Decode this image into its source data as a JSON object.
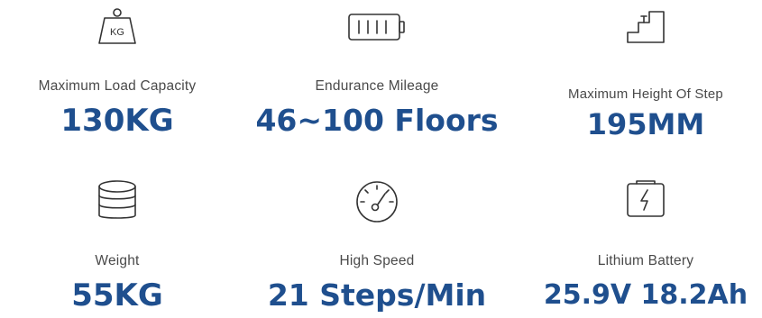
{
  "specs": [
    {
      "icon": "weight-kg-icon",
      "icon_text": "KG",
      "label": "Maximum Load Capacity",
      "value": "130KG"
    },
    {
      "icon": "battery-icon",
      "label": "Endurance Mileage",
      "value": "46~100 Floors"
    },
    {
      "icon": "stairs-icon",
      "label": "Maximum Height Of Step",
      "value": "195MM"
    },
    {
      "icon": "stacked-discs-icon",
      "label": "Weight",
      "value": "55KG"
    },
    {
      "icon": "speedometer-icon",
      "label": "High Speed",
      "value": "21 Steps/Min"
    },
    {
      "icon": "lithium-battery-icon",
      "label": "Lithium Battery",
      "value": "25.9V 18.2Ah"
    }
  ],
  "colors": {
    "value": "#1f4f8e",
    "label": "#4a4a4a",
    "icon": "#333333"
  }
}
